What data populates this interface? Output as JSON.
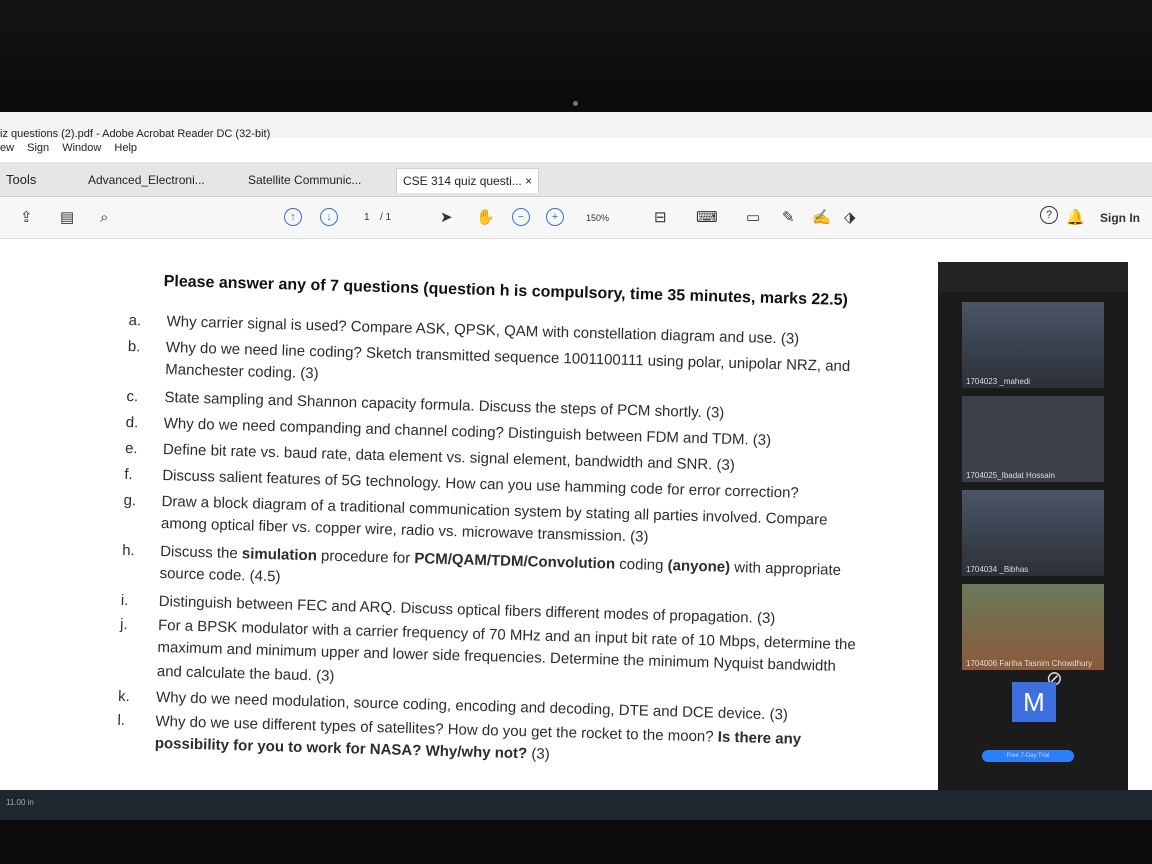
{
  "window": {
    "title": "iz questions (2).pdf - Adobe Acrobat Reader DC (32-bit)",
    "menu": [
      "ew",
      "Sign",
      "Window",
      "Help"
    ],
    "controls": [
      "–",
      "□",
      "×"
    ]
  },
  "tabs": {
    "tools": "Tools",
    "items": [
      {
        "label": "Advanced_Electroni..."
      },
      {
        "label": "Satellite Communic..."
      },
      {
        "label": "CSE 314 quiz questi...  ×"
      }
    ]
  },
  "toolbar": {
    "page_current": "1",
    "page_total": "/ 1",
    "zoom": "150%",
    "sign_in": "Sign In",
    "help_icon": "?",
    "bell_icon": "bell-icon"
  },
  "document": {
    "heading": "Please answer any of 7 questions (question h is compulsory, time 35 minutes, marks 22.5)",
    "questions": [
      {
        "label": "a.",
        "text": "Why carrier signal is used? Compare ASK, QPSK, QAM with constellation diagram and use. (3)"
      },
      {
        "label": "b.",
        "text": "Why do we need line coding? Sketch transmitted sequence 1001100111 using polar, unipolar NRZ, and",
        "cont": "Manchester coding. (3)"
      },
      {
        "label": "c.",
        "text": "State sampling and Shannon capacity formula. Discuss the steps of PCM shortly. (3)"
      },
      {
        "label": "d.",
        "text": "Why do we need companding and channel coding? Distinguish between FDM and TDM. (3)"
      },
      {
        "label": "e.",
        "text": "Define bit rate vs. baud rate, data element vs. signal element, bandwidth and SNR. (3)"
      },
      {
        "label": "f.",
        "text": "Discuss salient features of 5G technology. How can you use hamming code for error correction?"
      },
      {
        "label": "g.",
        "text": "Draw a block diagram of a traditional communication system by stating all parties involved. Compare",
        "cont": "among optical fiber vs. copper wire, radio vs. microwave transmission. (3)"
      },
      {
        "label": "h.",
        "text_pre": "Discuss the ",
        "text_b1": "simulation",
        "text_mid": " procedure for ",
        "text_b2": "PCM/QAM/TDM/Convolution",
        "text_mid2": " coding ",
        "text_b3": "(anyone)",
        "text_post": " with appropriate",
        "cont": "source code. (4.5)"
      },
      {
        "label": "i.",
        "text": "Distinguish between FEC and ARQ. Discuss optical fibers different modes of propagation. (3)"
      },
      {
        "label": "j.",
        "text": "For a BPSK modulator with a carrier frequency of 70 MHz and an input bit rate of 10 Mbps, determine the",
        "cont": "maximum and minimum upper and lower side frequencies. Determine the minimum Nyquist bandwidth",
        "cont2": "and calculate the baud. (3)"
      },
      {
        "label": "k.",
        "text": "Why do we need modulation, source coding, encoding and decoding, DTE and DCE device. (3)"
      },
      {
        "label": "l.",
        "text_pre": "Why do we use different types of satellites? How do you get the rocket to the moon? ",
        "text_b1": "Is there any",
        "cont_b": "possibility for you to work for NASA? Why/why not?",
        "cont_post": " (3)"
      }
    ]
  },
  "zoom_panel": {
    "participants": [
      {
        "name": "1704023 _mahedi"
      },
      {
        "name": "1704025_Ibadat Hossain"
      },
      {
        "name": "1704034 _Bibhas"
      },
      {
        "name": "1704006 Fariha Tasnim Chowdhury"
      }
    ],
    "avatar_letter": "M",
    "trial_label": "Free 7-Day Trial"
  },
  "status": {
    "page_size": "11.00 in"
  }
}
